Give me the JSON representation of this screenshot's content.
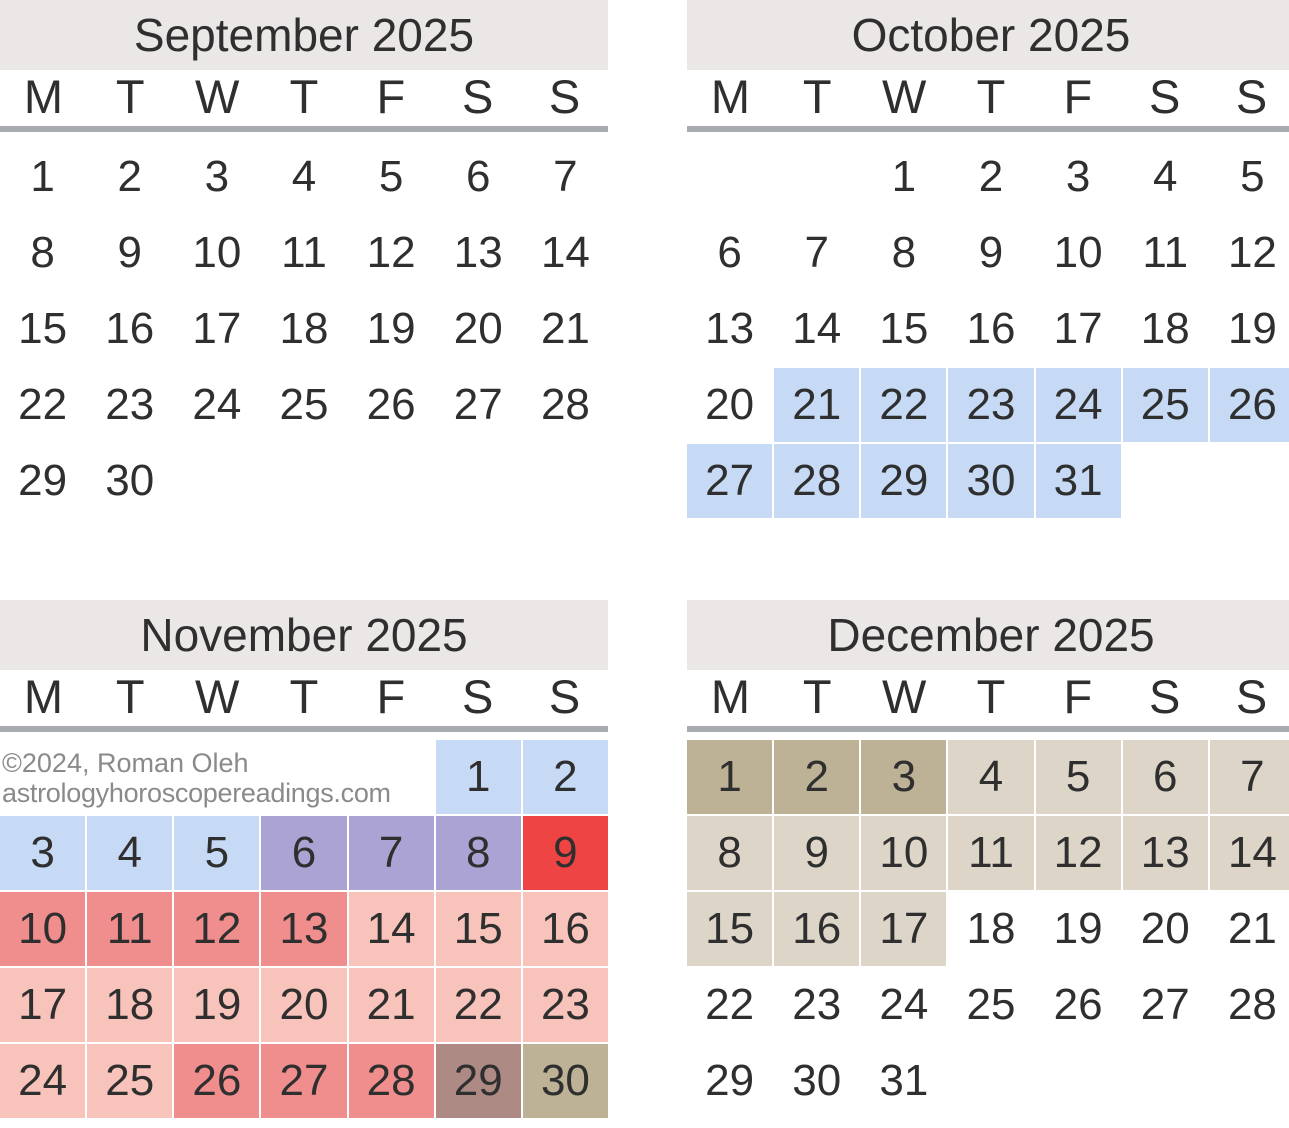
{
  "page": {
    "title": "Quarterly Calendar September - December 2025",
    "background": "#ffffff"
  },
  "copyright": {
    "line1": "©2024, Roman Oleh",
    "line2": "astrologyhoroscopereadings.com"
  },
  "weekday_labels": [
    "M",
    "T",
    "W",
    "T",
    "F",
    "S",
    "S"
  ],
  "colors": {
    "header_bg": "#eae7e6",
    "rule": "#a8abb0",
    "text": "#2f2f2f",
    "copyright_text": "#8a8a8a",
    "blue": "#c6daf6",
    "purple": "#aba3d4",
    "red": "#ef4444",
    "salmon_dark": "#f08d8d",
    "salmon_light": "#f7c3bb",
    "brown": "#ad8a84",
    "khaki": "#bdb196",
    "beige": "#ddd5c8"
  },
  "months": [
    {
      "name": "september",
      "title": "September 2025",
      "lead_blanks": 0,
      "days": [
        {
          "n": "1",
          "bg": null
        },
        {
          "n": "2",
          "bg": null
        },
        {
          "n": "3",
          "bg": null
        },
        {
          "n": "4",
          "bg": null
        },
        {
          "n": "5",
          "bg": null
        },
        {
          "n": "6",
          "bg": null
        },
        {
          "n": "7",
          "bg": null
        },
        {
          "n": "8",
          "bg": null
        },
        {
          "n": "9",
          "bg": null
        },
        {
          "n": "10",
          "bg": null
        },
        {
          "n": "11",
          "bg": null
        },
        {
          "n": "12",
          "bg": null
        },
        {
          "n": "13",
          "bg": null
        },
        {
          "n": "14",
          "bg": null
        },
        {
          "n": "15",
          "bg": null
        },
        {
          "n": "16",
          "bg": null
        },
        {
          "n": "17",
          "bg": null
        },
        {
          "n": "18",
          "bg": null
        },
        {
          "n": "19",
          "bg": null
        },
        {
          "n": "20",
          "bg": null
        },
        {
          "n": "21",
          "bg": null
        },
        {
          "n": "22",
          "bg": null
        },
        {
          "n": "23",
          "bg": null
        },
        {
          "n": "24",
          "bg": null
        },
        {
          "n": "25",
          "bg": null
        },
        {
          "n": "26",
          "bg": null
        },
        {
          "n": "27",
          "bg": null
        },
        {
          "n": "28",
          "bg": null
        },
        {
          "n": "29",
          "bg": null
        },
        {
          "n": "30",
          "bg": null
        }
      ]
    },
    {
      "name": "october",
      "title": "October 2025",
      "lead_blanks": 2,
      "days": [
        {
          "n": "1",
          "bg": null
        },
        {
          "n": "2",
          "bg": null
        },
        {
          "n": "3",
          "bg": null
        },
        {
          "n": "4",
          "bg": null
        },
        {
          "n": "5",
          "bg": null
        },
        {
          "n": "6",
          "bg": null
        },
        {
          "n": "7",
          "bg": null
        },
        {
          "n": "8",
          "bg": null
        },
        {
          "n": "9",
          "bg": null
        },
        {
          "n": "10",
          "bg": null
        },
        {
          "n": "11",
          "bg": null
        },
        {
          "n": "12",
          "bg": null
        },
        {
          "n": "13",
          "bg": null
        },
        {
          "n": "14",
          "bg": null
        },
        {
          "n": "15",
          "bg": null
        },
        {
          "n": "16",
          "bg": null
        },
        {
          "n": "17",
          "bg": null
        },
        {
          "n": "18",
          "bg": null
        },
        {
          "n": "19",
          "bg": null
        },
        {
          "n": "20",
          "bg": null
        },
        {
          "n": "21",
          "bg": "#c6daf6"
        },
        {
          "n": "22",
          "bg": "#c6daf6"
        },
        {
          "n": "23",
          "bg": "#c6daf6"
        },
        {
          "n": "24",
          "bg": "#c6daf6"
        },
        {
          "n": "25",
          "bg": "#c6daf6"
        },
        {
          "n": "26",
          "bg": "#c6daf6"
        },
        {
          "n": "27",
          "bg": "#c6daf6"
        },
        {
          "n": "28",
          "bg": "#c6daf6"
        },
        {
          "n": "29",
          "bg": "#c6daf6"
        },
        {
          "n": "30",
          "bg": "#c6daf6"
        },
        {
          "n": "31",
          "bg": "#c6daf6"
        }
      ]
    },
    {
      "name": "november",
      "title": "November 2025",
      "lead_blanks": 5,
      "days": [
        {
          "n": "1",
          "bg": "#c6daf6"
        },
        {
          "n": "2",
          "bg": "#c6daf6"
        },
        {
          "n": "3",
          "bg": "#c6daf6"
        },
        {
          "n": "4",
          "bg": "#c6daf6"
        },
        {
          "n": "5",
          "bg": "#c6daf6"
        },
        {
          "n": "6",
          "bg": "#aba3d4"
        },
        {
          "n": "7",
          "bg": "#aba3d4"
        },
        {
          "n": "8",
          "bg": "#aba3d4"
        },
        {
          "n": "9",
          "bg": "#ef4444"
        },
        {
          "n": "10",
          "bg": "#f08d8d"
        },
        {
          "n": "11",
          "bg": "#f08d8d"
        },
        {
          "n": "12",
          "bg": "#f08d8d"
        },
        {
          "n": "13",
          "bg": "#f08d8d"
        },
        {
          "n": "14",
          "bg": "#f7c3bb"
        },
        {
          "n": "15",
          "bg": "#f7c3bb"
        },
        {
          "n": "16",
          "bg": "#f7c3bb"
        },
        {
          "n": "17",
          "bg": "#f7c3bb"
        },
        {
          "n": "18",
          "bg": "#f7c3bb"
        },
        {
          "n": "19",
          "bg": "#f7c3bb"
        },
        {
          "n": "20",
          "bg": "#f7c3bb"
        },
        {
          "n": "21",
          "bg": "#f7c3bb"
        },
        {
          "n": "22",
          "bg": "#f7c3bb"
        },
        {
          "n": "23",
          "bg": "#f7c3bb"
        },
        {
          "n": "24",
          "bg": "#f7c3bb"
        },
        {
          "n": "25",
          "bg": "#f7c3bb"
        },
        {
          "n": "26",
          "bg": "#f08d8d"
        },
        {
          "n": "27",
          "bg": "#f08d8d"
        },
        {
          "n": "28",
          "bg": "#f08d8d"
        },
        {
          "n": "29",
          "bg": "#ad8a84"
        },
        {
          "n": "30",
          "bg": "#bdb196"
        }
      ]
    },
    {
      "name": "december",
      "title": "December 2025",
      "lead_blanks": 0,
      "days": [
        {
          "n": "1",
          "bg": "#bdb196"
        },
        {
          "n": "2",
          "bg": "#bdb196"
        },
        {
          "n": "3",
          "bg": "#bdb196"
        },
        {
          "n": "4",
          "bg": "#ddd5c8"
        },
        {
          "n": "5",
          "bg": "#ddd5c8"
        },
        {
          "n": "6",
          "bg": "#ddd5c8"
        },
        {
          "n": "7",
          "bg": "#ddd5c8"
        },
        {
          "n": "8",
          "bg": "#ddd5c8"
        },
        {
          "n": "9",
          "bg": "#ddd5c8"
        },
        {
          "n": "10",
          "bg": "#ddd5c8"
        },
        {
          "n": "11",
          "bg": "#ddd5c8"
        },
        {
          "n": "12",
          "bg": "#ddd5c8"
        },
        {
          "n": "13",
          "bg": "#ddd5c8"
        },
        {
          "n": "14",
          "bg": "#ddd5c8"
        },
        {
          "n": "15",
          "bg": "#ddd5c8"
        },
        {
          "n": "16",
          "bg": "#ddd5c8"
        },
        {
          "n": "17",
          "bg": "#ddd5c8"
        },
        {
          "n": "18",
          "bg": null
        },
        {
          "n": "19",
          "bg": null
        },
        {
          "n": "20",
          "bg": null
        },
        {
          "n": "21",
          "bg": null
        },
        {
          "n": "22",
          "bg": null
        },
        {
          "n": "23",
          "bg": null
        },
        {
          "n": "24",
          "bg": null
        },
        {
          "n": "25",
          "bg": null
        },
        {
          "n": "26",
          "bg": null
        },
        {
          "n": "27",
          "bg": null
        },
        {
          "n": "28",
          "bg": null
        },
        {
          "n": "29",
          "bg": null
        },
        {
          "n": "30",
          "bg": null
        },
        {
          "n": "31",
          "bg": null
        }
      ]
    }
  ]
}
